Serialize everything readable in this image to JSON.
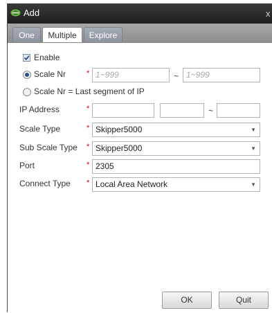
{
  "window": {
    "title": "Add",
    "close": "x"
  },
  "tabs": [
    {
      "label": "One",
      "active": false
    },
    {
      "label": "Multiple",
      "active": true
    },
    {
      "label": "Explore",
      "active": false
    }
  ],
  "form": {
    "enable": {
      "label": "Enable",
      "checked": true
    },
    "scale_nr": {
      "label": "Scale Nr",
      "selected": true,
      "from_placeholder": "1~999",
      "separator": "~",
      "to_placeholder": "1~999"
    },
    "scale_nr_ip": {
      "label": "Scale Nr = Last segment of IP",
      "selected": false
    },
    "ip_address": {
      "label": "IP Address",
      "part1": "",
      "part2": "",
      "separator": "~",
      "part3": ""
    },
    "scale_type": {
      "label": "Scale Type",
      "value": "Skipper5000"
    },
    "sub_scale_type": {
      "label": "Sub Scale Type",
      "value": "Skipper5000"
    },
    "port": {
      "label": "Port",
      "value": "2305"
    },
    "connect_type": {
      "label": "Connect Type",
      "value": "Local Area Network"
    },
    "required_mark": "*"
  },
  "buttons": {
    "ok": "OK",
    "quit": "Quit"
  }
}
